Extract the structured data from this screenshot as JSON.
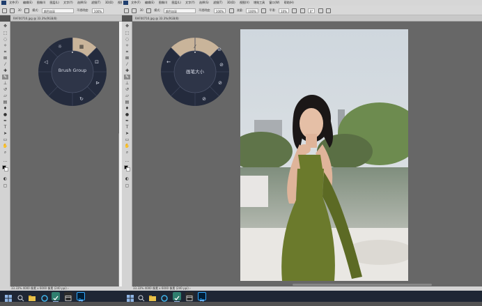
{
  "left_window": {
    "menu": [
      "文件(F)",
      "编辑(E)",
      "图像(I)",
      "图层(L)",
      "文字(Y)",
      "选择(S)",
      "滤镜(T)",
      "3D(D)",
      "视图(V)",
      "窗口(W)",
      "帮助(H)"
    ],
    "options": {
      "mode_label": "模式:",
      "mode_value": "颜色加深",
      "opacity_label": "不透明度:",
      "opacity_value": "100%",
      "size_value": "30"
    },
    "doc_tab": "RAF00716.jpg @ 33.3%(RGB/8)",
    "status": "33.33%     4000 像素 x 6000 像素 (240 ppi)   ›",
    "wheel_label": "Brush Group"
  },
  "right_window": {
    "menu": [
      "文件(F)",
      "编辑(E)",
      "图像(I)",
      "图层(L)",
      "文字(Y)",
      "选择(S)",
      "滤镜(T)",
      "3D(D)",
      "视图(V)",
      "增效工具",
      "窗口(W)",
      "帮助(H)"
    ],
    "options": {
      "mode_label": "模式:",
      "mode_value": "颜色加深",
      "opacity_label": "不透明度:",
      "opacity_value": "100%",
      "flow_label": "流量:",
      "flow_value": "100%",
      "smooth_label": "平滑:",
      "smooth_value": "10%",
      "angle_value": "0°",
      "size_value": "30"
    },
    "doc_tab": "RAF00716.jpg @ 33.3%(RGB/8)",
    "status": "33.33%     4000 像素 x 6000 像素 (240 ppi)   ›",
    "wheel_label": "画笔大小"
  },
  "taskbar": {
    "items": [
      "start-icon",
      "search-icon",
      "file-explorer-icon",
      "cortana-icon",
      "checkmark-app-icon",
      "calendar-app-icon",
      "photoshop-icon"
    ]
  },
  "colors": {
    "wheel_dark": "#242b3d",
    "wheel_ring": "#2e3548",
    "wheel_accent": "#c9b49a",
    "canvas": "#676767",
    "panel": "#d3d3d3",
    "taskbar": "#1e2634"
  }
}
